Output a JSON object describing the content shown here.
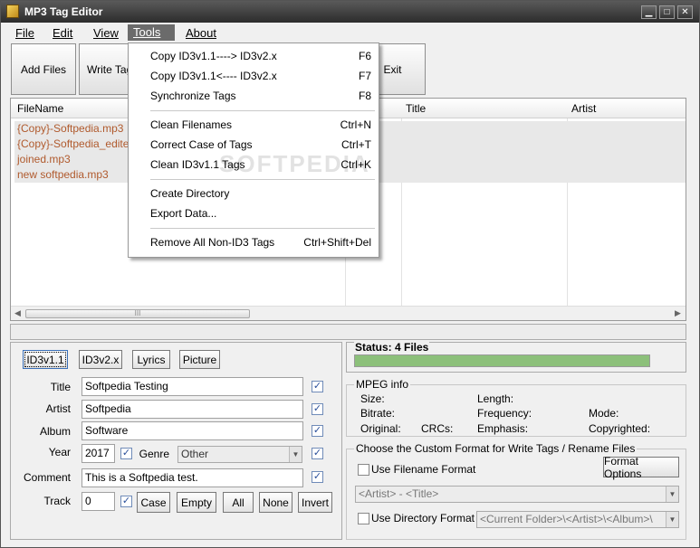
{
  "window": {
    "title": "MP3 Tag Editor"
  },
  "menubar": {
    "file": "File",
    "edit": "Edit",
    "view": "View",
    "tools": "Tools",
    "about": "About"
  },
  "toolbar": {
    "add_files": "Add Files",
    "write_tags": "Write Tag",
    "exit": "Exit"
  },
  "file_list": {
    "columns": {
      "filename": "FileName",
      "title": "Title",
      "artist": "Artist"
    },
    "rows": [
      "{Copy}-Softpedia.mp3",
      "{Copy}-Softpedia_edited.m",
      "joined.mp3",
      "new softpedia.mp3"
    ],
    "scroll_thumb": "III"
  },
  "tools_menu": {
    "items": [
      {
        "label": "Copy ID3v1.1----> ID3v2.x",
        "key": "F6"
      },
      {
        "label": "Copy ID3v1.1<---- ID3v2.x",
        "key": "F7"
      },
      {
        "label": "Synchronize Tags",
        "key": "F8"
      },
      {
        "label": "Clean Filenames",
        "key": "Ctrl+N"
      },
      {
        "label": "Correct Case of Tags",
        "key": "Ctrl+T"
      },
      {
        "label": "Clean ID3v1.1 Tags",
        "key": "Ctrl+K"
      },
      {
        "label": "Create Directory",
        "key": ""
      },
      {
        "label": "Export Data...",
        "key": ""
      },
      {
        "label": "Remove All Non-ID3 Tags",
        "key": "Ctrl+Shift+Del"
      }
    ],
    "watermark": "SOFTPEDIA"
  },
  "tag_tabs": {
    "id3v1": "ID3v1.1",
    "id3v2": "ID3v2.x",
    "lyrics": "Lyrics",
    "picture": "Picture"
  },
  "tag_fields": {
    "title_label": "Title",
    "title_value": "Softpedia Testing",
    "artist_label": "Artist",
    "artist_value": "Softpedia",
    "album_label": "Album",
    "album_value": "Software",
    "year_label": "Year",
    "year_value": "2017",
    "genre_label": "Genre",
    "genre_value": "Other",
    "comment_label": "Comment",
    "comment_value": "This is a Softpedia test.",
    "track_label": "Track",
    "track_value": "0"
  },
  "track_buttons": {
    "case": "Case",
    "empty": "Empty",
    "all": "All",
    "none": "None",
    "invert": "Invert"
  },
  "status": {
    "label": "Status: 4 Files",
    "progress": 1.0
  },
  "mpeg_info": {
    "title": "MPEG info",
    "size": "Size:",
    "length": "Length:",
    "bitrate": "Bitrate:",
    "frequency": "Frequency:",
    "mode": "Mode:",
    "original": "Original:",
    "crcs": "CRCs:",
    "emphasis": "Emphasis:",
    "copyrighted": "Copyrighted:"
  },
  "custom_format": {
    "title": "Choose the Custom Format for Write Tags / Rename Files",
    "use_filename": "Use Filename Format",
    "format_options": "Format Options",
    "filename_format": "<Artist> - <Title>",
    "use_directory": "Use Directory Format",
    "directory_format": "<Current Folder>\\<Artist>\\<Album>\\"
  },
  "colors": {
    "menu_active": "#6b6b6b",
    "row_text": "#b05a2d",
    "row_bg": "#e8e8e8"
  }
}
